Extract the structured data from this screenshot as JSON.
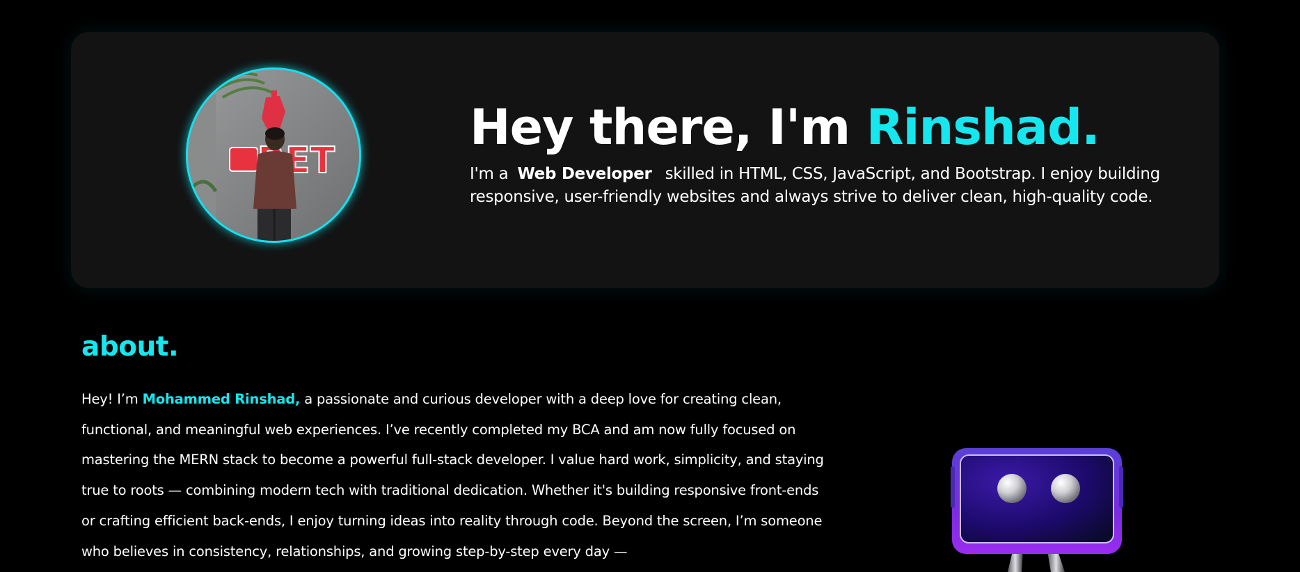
{
  "hero": {
    "title_prefix": "Hey there, I'm ",
    "title_name": "Rinshad.",
    "desc_prefix": "I'm a",
    "desc_role": "Web Developer",
    "desc_suffix": "skilled in HTML, CSS, JavaScript, and Bootstrap. I enjoy building responsive, user-friendly websites and always strive to deliver clean, high-quality code.",
    "avatar_sign_text": "RET"
  },
  "about": {
    "heading": "about.",
    "text_prefix": "Hey! I’m ",
    "name": "Mohammed Rinshad,",
    "text_body": " a passionate and curious developer with a deep love for creating clean, functional, and meaningful web experiences. I’ve recently completed my BCA and am now fully focused on mastering the MERN stack to become a powerful full-stack developer. I value hard work, simplicity, and staying true to roots — combining modern tech with traditional dedication. Whether it's building responsive front-ends or crafting efficient back-ends, I enjoy turning ideas into reality through code. Beyond the screen, I’m someone who believes in consistency, relationships, and growing step-by-step every day —"
  },
  "colors": {
    "background": "#000000",
    "card": "#131313",
    "accent": "#16e7ef",
    "text": "#ffffff",
    "robot_screen": "#2a0a8a"
  },
  "icons": {
    "robot": "robot-illustration"
  }
}
